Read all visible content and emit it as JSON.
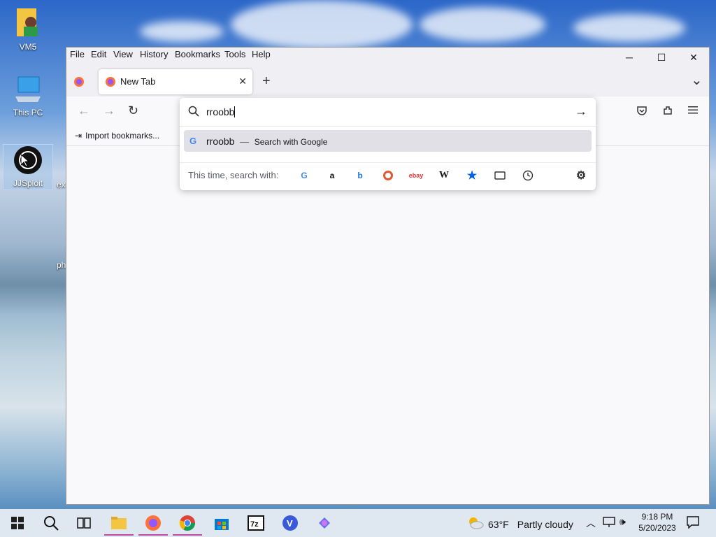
{
  "desktop": {
    "icons": [
      {
        "label": "VM5"
      },
      {
        "label": "This PC"
      },
      {
        "label": "JJSploit"
      }
    ],
    "partial_labels": [
      "ex",
      "ph"
    ]
  },
  "window": {
    "menu": [
      "File",
      "Edit",
      "View",
      "History",
      "Bookmarks",
      "Tools",
      "Help"
    ],
    "controls": {
      "minimize": "─",
      "maximize": "☐",
      "close": "✕"
    },
    "tab": {
      "title": "New Tab",
      "close": "✕"
    },
    "new_tab": "+",
    "list_tabs": "⌄",
    "bookmarks_bar": {
      "import": "Import bookmarks..."
    }
  },
  "urlbar": {
    "value": "rroobb",
    "suggestion": {
      "query": "rroobb",
      "separator": "—",
      "action": "Search with Google"
    },
    "search_with_label": "This time, search with:",
    "engines": [
      "google",
      "amazon",
      "bing",
      "duckduckgo",
      "ebay",
      "wikipedia",
      "bookmarks",
      "tabs",
      "history"
    ]
  },
  "taskbar": {
    "weather": {
      "temp": "63°F",
      "condition": "Partly cloudy"
    },
    "clock": {
      "time": "9:18 PM",
      "date": "5/20/2023"
    }
  },
  "colors": {
    "accent": "#0061e0",
    "taskbar_bg": "#dfe7f0",
    "active_underline": "#c04ba0"
  }
}
